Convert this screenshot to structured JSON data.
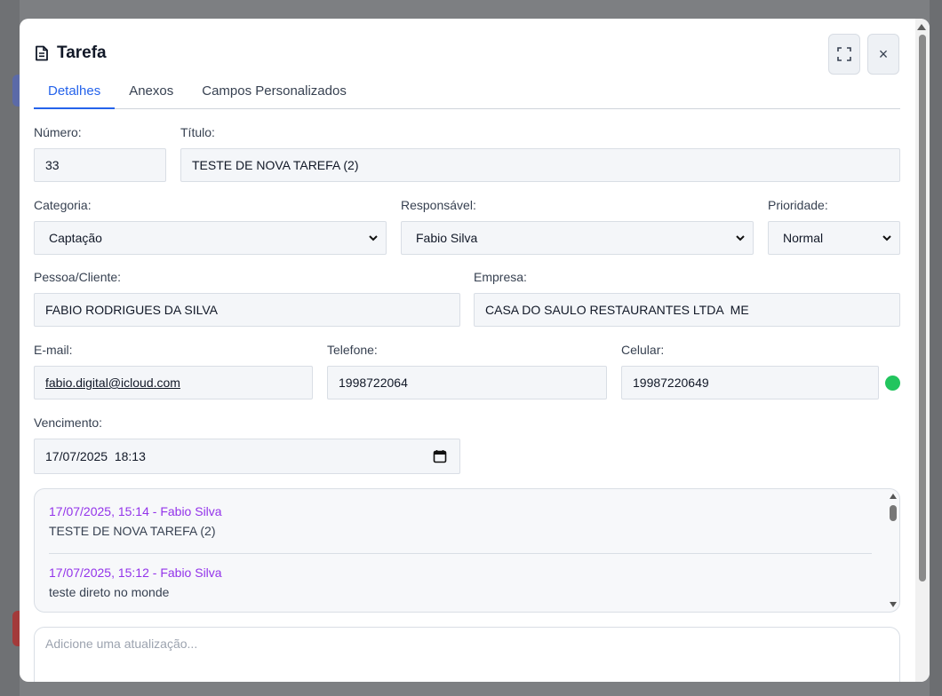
{
  "modal": {
    "title": "Tarefa",
    "icons": {
      "title": "document-icon",
      "expand": "expand-icon",
      "close": "close-icon"
    },
    "close_glyph": "×"
  },
  "tabs": [
    {
      "label": "Detalhes",
      "active": true
    },
    {
      "label": "Anexos",
      "active": false
    },
    {
      "label": "Campos Personalizados",
      "active": false
    }
  ],
  "form": {
    "numero": {
      "label": "Número:",
      "value": "33"
    },
    "titulo": {
      "label": "Título:",
      "value": "TESTE DE NOVA TAREFA (2)"
    },
    "categoria": {
      "label": "Categoria:",
      "value": "Captação"
    },
    "responsavel": {
      "label": "Responsável:",
      "value": "Fabio Silva"
    },
    "prioridade": {
      "label": "Prioridade:",
      "value": "Normal"
    },
    "pessoa": {
      "label": "Pessoa/Cliente:",
      "value": "FABIO RODRIGUES DA SILVA"
    },
    "empresa": {
      "label": "Empresa:",
      "value": "CASA DO SAULO RESTAURANTES LTDA  ME"
    },
    "email": {
      "label": "E-mail:",
      "value": "fabio.digital@icloud.com"
    },
    "telefone": {
      "label": "Telefone:",
      "value": "1998722064"
    },
    "celular": {
      "label": "Celular:",
      "value": "19987220649",
      "status_color": "#22c55e"
    },
    "vencimento": {
      "label": "Vencimento:",
      "value": "17/07/2025  18:13"
    }
  },
  "history": [
    {
      "meta": "17/07/2025, 15:14 - Fabio Silva",
      "message": "TESTE DE NOVA TAREFA (2)"
    },
    {
      "meta": "17/07/2025, 15:12 - Fabio Silva",
      "message": "teste direto no monde"
    }
  ],
  "update": {
    "placeholder": "Adicione uma atualização..."
  },
  "colors": {
    "accent": "#2563eb",
    "history_meta": "#9333ea",
    "status_ok": "#22c55e"
  }
}
